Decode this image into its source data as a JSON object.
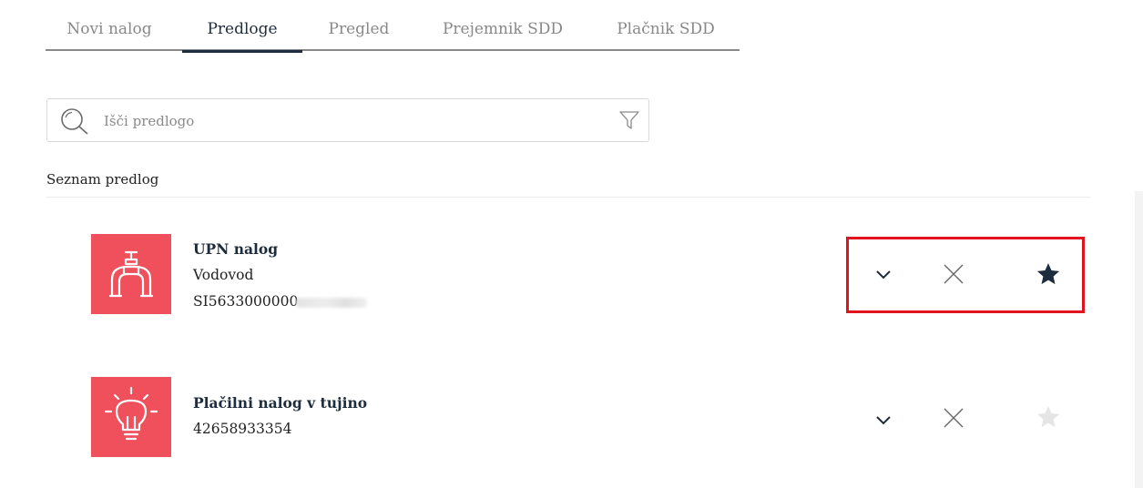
{
  "tabs": [
    {
      "label": "Novi nalog",
      "active": false
    },
    {
      "label": "Predloge",
      "active": true
    },
    {
      "label": "Pregled",
      "active": false
    },
    {
      "label": "Prejemnik SDD",
      "active": false
    },
    {
      "label": "Plačnik SDD",
      "active": false
    }
  ],
  "search": {
    "placeholder": "Išči predlogo",
    "value": ""
  },
  "list": {
    "title": "Seznam predlog"
  },
  "templates": [
    {
      "icon": "water-tap-icon",
      "name": "UPN nalog",
      "recipient": "Vodovod",
      "account": "SI5633000000",
      "account_note": "remaining digits blurred",
      "favorite": true
    },
    {
      "icon": "lightbulb-icon",
      "name": "Plačilni nalog v tujino",
      "account": "42658933354",
      "favorite": false
    }
  ],
  "colors": {
    "accent": "#f0505b",
    "primary": "#1e2d3d",
    "highlight": "#e0141e",
    "star_inactive": "#e5e5e5"
  }
}
